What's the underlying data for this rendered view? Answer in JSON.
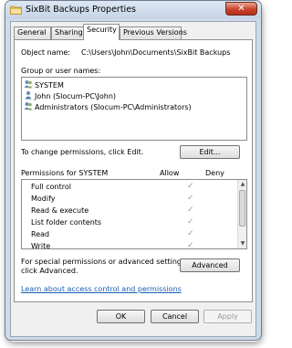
{
  "window": {
    "title": "SixBit Backups Properties",
    "close_glyph": "✕"
  },
  "tabs": [
    {
      "label": "General"
    },
    {
      "label": "Sharing"
    },
    {
      "label": "Security"
    },
    {
      "label": "Previous Versions"
    }
  ],
  "security": {
    "object_name_label": "Object name:",
    "object_name_value": "C:\\Users\\John\\Documents\\SixBit Backups",
    "group_label": "Group or user names:",
    "users": [
      {
        "name": "SYSTEM",
        "icon": "users-group-icon"
      },
      {
        "name": "John (Slocum-PC\\John)",
        "icon": "user-icon"
      },
      {
        "name": "Administrators (Slocum-PC\\Administrators)",
        "icon": "users-group-icon"
      }
    ],
    "change_text": "To change permissions, click Edit.",
    "edit_button": "Edit...",
    "permissions_label": "Permissions for SYSTEM",
    "allow_header": "Allow",
    "deny_header": "Deny",
    "check_glyph": "✓",
    "permissions": [
      {
        "name": "Full control",
        "allow": true
      },
      {
        "name": "Modify",
        "allow": true
      },
      {
        "name": "Read & execute",
        "allow": true
      },
      {
        "name": "List folder contents",
        "allow": true
      },
      {
        "name": "Read",
        "allow": true
      },
      {
        "name": "Write",
        "allow": true
      }
    ],
    "special_text_line1": "For special permissions or advanced settings,",
    "special_text_line2": "click Advanced.",
    "advanced_button": "Advanced",
    "learn_link": "Learn about access control and permissions"
  },
  "buttons": {
    "ok": "OK",
    "cancel": "Cancel",
    "apply": "Apply"
  }
}
